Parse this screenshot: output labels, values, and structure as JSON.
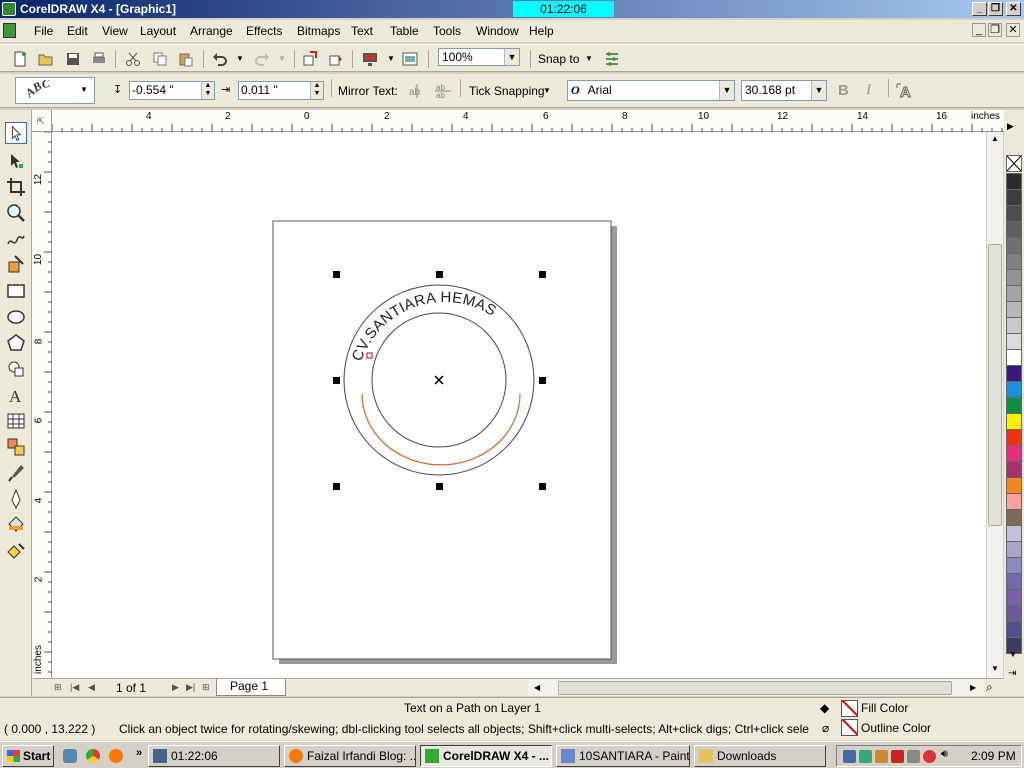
{
  "window": {
    "title": "CorelDRAW X4 - [Graphic1]",
    "clock": "01:22:06"
  },
  "menu": [
    "File",
    "Edit",
    "View",
    "Layout",
    "Arrange",
    "Effects",
    "Bitmaps",
    "Text",
    "Table",
    "Tools",
    "Window",
    "Help"
  ],
  "standard_toolbar": {
    "zoom": "100%",
    "snap_to": "Snap to"
  },
  "property_bar": {
    "distance_from_path": "-0.554 \"",
    "offset": "0.011 \"",
    "mirror_text_label": "Mirror Text:",
    "tick_snapping": "Tick Snapping",
    "font_name": "Arial",
    "font_size": "30.168 pt",
    "bold": "B",
    "italic": "I"
  },
  "rulers": {
    "top_ticks": [
      "4",
      "2",
      "0",
      "2",
      "4",
      "6",
      "8",
      "10",
      "12",
      "14",
      "16"
    ],
    "top_unit": "inches",
    "left_ticks": [
      "12",
      "10",
      "8",
      "6",
      "4",
      "2"
    ],
    "left_unit": "inches"
  },
  "drawing": {
    "path_text": "CV.SANTIARA HEMAS"
  },
  "pages": {
    "count": "1 of 1",
    "tab": "Page 1"
  },
  "status": {
    "object_info": "Text on a Path on Layer 1",
    "coordinates": "( 0.000 , 13.222 )",
    "hint": "Click an object twice for rotating/skewing; dbl-clicking tool selects all objects; Shift+click multi-selects; Alt+click digs; Ctrl+click selects in a group",
    "fill_label": "Fill Color",
    "outline_label": "Outline Color"
  },
  "palette": [
    "#2b2b2b",
    "#3d3d3d",
    "#4e4e4e",
    "#5f5f5f",
    "#707070",
    "#808080",
    "#939393",
    "#a5a5a5",
    "#b7b7b7",
    "#c9c9c9",
    "#dbdbdb",
    "#ffffff",
    "#3b1880",
    "#1b8fe0",
    "#0b8f3e",
    "#ffef00",
    "#f03010",
    "#e82a80",
    "#a8306e",
    "#f5871e",
    "#f8a0a0",
    "#7d6a5a",
    "#c4c0d8",
    "#a8a4cc",
    "#8c88c0",
    "#6e6aae",
    "#7a60a8",
    "#6a5a98",
    "#50508a",
    "#3c3c5c"
  ],
  "taskbar": {
    "start": "Start",
    "clock_app": "01:22:06",
    "tasks": [
      "Faizal Irfandi Blog: ...",
      "CorelDRAW X4 - ...",
      "10SANTIARA - Paint",
      "Downloads"
    ],
    "time": "2:09 PM"
  }
}
